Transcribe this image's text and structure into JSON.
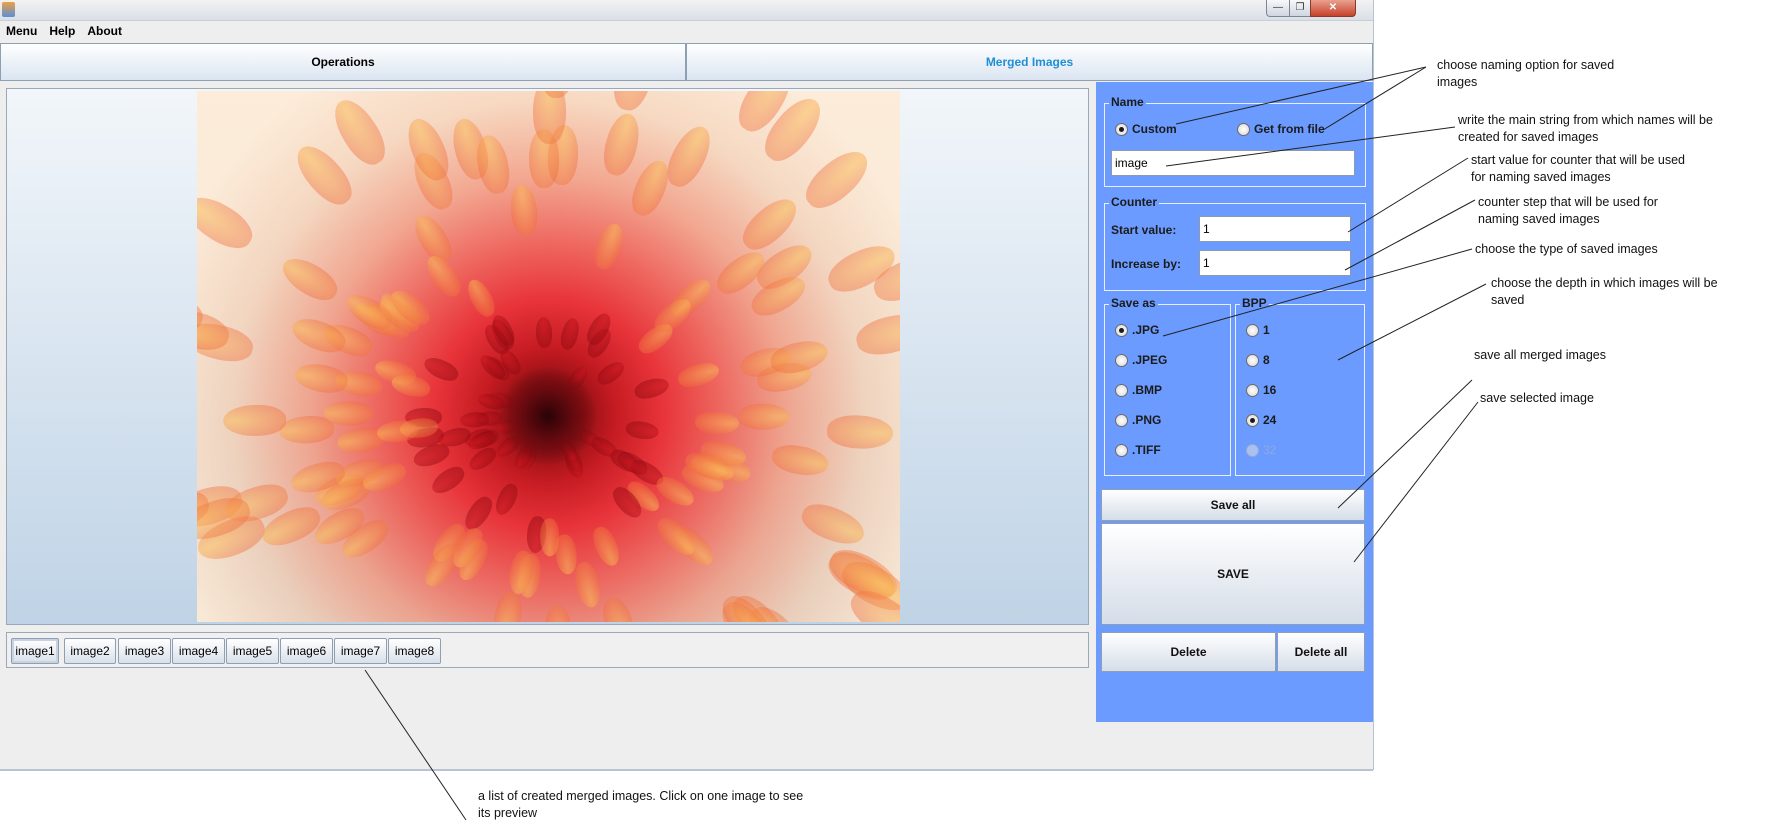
{
  "menu": [
    "Menu",
    "Help",
    "About"
  ],
  "tabs": [
    {
      "label": "Operations",
      "active": false
    },
    {
      "label": "Merged Images",
      "active": true
    }
  ],
  "name_group": {
    "title": "Name",
    "options": [
      {
        "label": "Custom",
        "checked": true
      },
      {
        "label": "Get from file",
        "checked": false
      }
    ],
    "value": "image"
  },
  "counter_group": {
    "title": "Counter",
    "start_label": "Start value:",
    "start_value": "1",
    "step_label": "Increase by:",
    "step_value": "1"
  },
  "save_as": {
    "title": "Save as",
    "options": [
      {
        "label": ".JPG",
        "checked": true
      },
      {
        "label": ".JPEG",
        "checked": false
      },
      {
        "label": ".BMP",
        "checked": false
      },
      {
        "label": ".PNG",
        "checked": false
      },
      {
        "label": ".TIFF",
        "checked": false
      }
    ]
  },
  "bpp": {
    "title": "BPP",
    "options": [
      {
        "label": "1",
        "checked": false,
        "enabled": true
      },
      {
        "label": "8",
        "checked": false,
        "enabled": true
      },
      {
        "label": "16",
        "checked": false,
        "enabled": true
      },
      {
        "label": "24",
        "checked": true,
        "enabled": true
      },
      {
        "label": "32",
        "checked": false,
        "enabled": false
      }
    ]
  },
  "buttons": {
    "save_all": "Save all",
    "save": "SAVE",
    "delete": "Delete",
    "delete_all": "Delete all"
  },
  "thumbnails": [
    "image1",
    "image2",
    "image3",
    "image4",
    "image5",
    "image6",
    "image7",
    "image8"
  ],
  "selected_thumbnail": "image1",
  "annotations": {
    "naming": [
      "choose naming option for saved",
      "images"
    ],
    "main_string": [
      "write the main string from which names will be",
      "created for saved images"
    ],
    "start_value": [
      "start value for counter that will be used",
      "for naming saved images"
    ],
    "counter_step": [
      "counter step that will be used for",
      "naming saved images"
    ],
    "type": [
      "choose the type of saved images"
    ],
    "depth": [
      "choose the depth in which images will be",
      "saved"
    ],
    "save_all": [
      "save all merged images"
    ],
    "save_selected": [
      "save selected image"
    ],
    "list": [
      "a list of created merged images. Click on one image to see",
      "its preview"
    ]
  },
  "colors": {
    "panel_blue": "#6b9bff",
    "active_tab_text": "#1e8fd6"
  }
}
